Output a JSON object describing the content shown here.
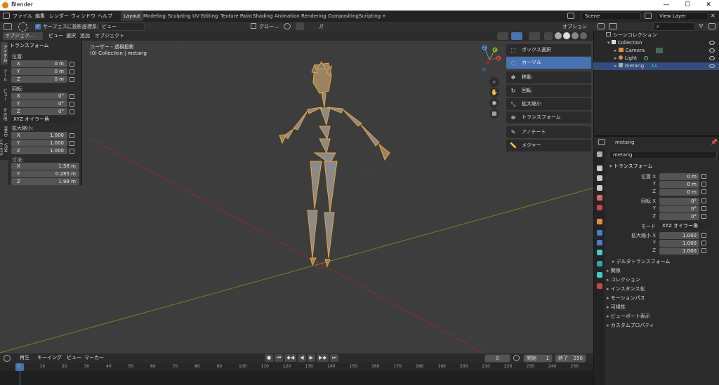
{
  "window": {
    "title": "Blender",
    "minimize": "—",
    "maximize": "☐",
    "close": "✕"
  },
  "menu": [
    "ファイル",
    "編集",
    "レンダー",
    "ウィンドウ",
    "ヘルプ"
  ],
  "workspaces": [
    "Layout",
    "Modeling",
    "Sculpting",
    "UV Editing",
    "Texture Paint",
    "Shading",
    "Animation",
    "Rendering",
    "Compositing",
    "Scripting"
  ],
  "workspace_add": "+",
  "scene": {
    "name": "Scene",
    "view_layer": "View Layer"
  },
  "header": {
    "snap_label": "サーフェスに投影",
    "coord_label": "座標系:",
    "coord_value": "ビュー",
    "pivot_label": "グロー…",
    "options": "オプション"
  },
  "header2": {
    "mode": "オブジェク…",
    "items": [
      "ビュー",
      "選択",
      "追加",
      "オブジェクト"
    ]
  },
  "side_tabs": [
    "アイテム",
    "ツール",
    "ビュー",
    "その他",
    "MMD",
    "VRM HELPER"
  ],
  "npanel": {
    "title": "トランスフォーム",
    "location_label": "位置:",
    "location": [
      {
        "k": "X",
        "v": "0 m"
      },
      {
        "k": "Y",
        "v": "0 m"
      },
      {
        "k": "Z",
        "v": "0 m"
      }
    ],
    "rotation_label": "回転:",
    "rotation": [
      {
        "k": "X",
        "v": "0°"
      },
      {
        "k": "Y",
        "v": "0°"
      },
      {
        "k": "Z",
        "v": "0°"
      }
    ],
    "rotation_mode": "XYZ オイラー角",
    "scale_label": "拡大縮小:",
    "scale": [
      {
        "k": "X",
        "v": "1.000"
      },
      {
        "k": "Y",
        "v": "1.000"
      },
      {
        "k": "Z",
        "v": "1.000"
      }
    ],
    "dims_label": "寸法:",
    "dims": [
      {
        "k": "X",
        "v": "1.58 m"
      },
      {
        "k": "Y",
        "v": "0.285 m"
      },
      {
        "k": "Z",
        "v": "1.98 m"
      }
    ]
  },
  "viewport_info": {
    "line1": "ユーザー・透視投影",
    "line2": "(0) Collection | metarig"
  },
  "tools": [
    "ボックス選択",
    "カーソル",
    "移動",
    "回転",
    "拡大縮小",
    "トランスフォーム",
    "アノテート",
    "メジャー"
  ],
  "gizmo": {
    "x": "X",
    "y": "Y",
    "z": "Z"
  },
  "outliner": {
    "search_placeholder": "",
    "items": [
      {
        "label": "シーンコレクション",
        "indent": 0
      },
      {
        "label": "Collection",
        "indent": 1
      },
      {
        "label": "Camera",
        "indent": 2
      },
      {
        "label": "Light",
        "indent": 2
      },
      {
        "label": "metarig",
        "indent": 2
      }
    ]
  },
  "properties": {
    "object_name": "metarig",
    "data_name": "metarig",
    "transform_title": "トランスフォーム",
    "loc_label": "位置 X",
    "rot_label": "回転 X",
    "scale_label": "拡大縮小 X",
    "y": "Y",
    "z": "Z",
    "loc": [
      "0 m",
      "0 m",
      "0 m"
    ],
    "rot": [
      "0°",
      "0°",
      "0°"
    ],
    "mode_label": "モード",
    "mode_value": "XYZ オイラー角",
    "scale": [
      "1.000",
      "1.000",
      "1.000"
    ],
    "delta": "デルタトランスフォーム",
    "sections": [
      "関係",
      "コレクション",
      "インスタンス化",
      "モーションパス",
      "可視性",
      "ビューポート表示",
      "カスタムプロパティ"
    ]
  },
  "timeline": {
    "playback": "再生",
    "keying": "キーイング",
    "view": "ビュー",
    "marker": "マーカー",
    "current_frame": "0",
    "start_label": "開始",
    "start": "1",
    "end_label": "終了",
    "end": "250",
    "ticks": [
      "0",
      "10",
      "20",
      "30",
      "40",
      "50",
      "60",
      "70",
      "80",
      "90",
      "100",
      "110",
      "120",
      "130",
      "140",
      "150",
      "160",
      "170",
      "180",
      "190",
      "200",
      "210",
      "220",
      "230",
      "240",
      "250"
    ]
  },
  "colors": {
    "accent": "#4772b3",
    "bone": "#e8a43d",
    "xaxis": "#8c2b32",
    "yaxis": "#6a8a20"
  }
}
